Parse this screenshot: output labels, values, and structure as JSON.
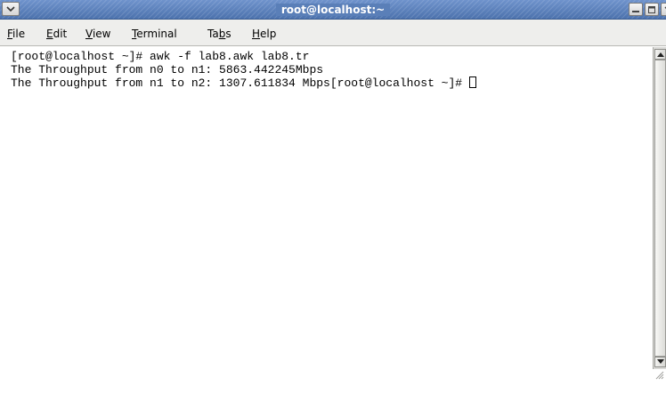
{
  "window": {
    "title": "root@localhost:~",
    "window_menu_icon": "chevron-down-icon",
    "minimize_icon": "minimize-icon",
    "maximize_icon": "maximize-icon",
    "close_icon": "close-icon",
    "titlebar_color": "#5a7fb8"
  },
  "menubar": {
    "items": [
      {
        "label": "File",
        "mnemonic": "F",
        "rest": "ile"
      },
      {
        "label": "Edit",
        "mnemonic": "E",
        "rest": "dit"
      },
      {
        "label": "View",
        "mnemonic": "V",
        "rest": "iew"
      },
      {
        "label": "Terminal",
        "mnemonic": "T",
        "rest": "erminal"
      },
      {
        "label": "Tabs",
        "pre": "Ta",
        "mnemonic": "b",
        "rest": "s"
      },
      {
        "label": "Help",
        "mnemonic": "H",
        "rest": "elp"
      }
    ]
  },
  "terminal": {
    "lines": [
      "[root@localhost ~]# awk -f lab8.awk lab8.tr",
      "The Throughput from n0 to n1: 5863.442245Mbps",
      "The Throughput from n1 to n2: 1307.611834 Mbps[root@localhost ~]# "
    ],
    "background": "#ffffff",
    "foreground": "#000000"
  },
  "scrollbar": {
    "up_icon": "scroll-up-arrow-icon",
    "down_icon": "scroll-down-arrow-icon"
  }
}
